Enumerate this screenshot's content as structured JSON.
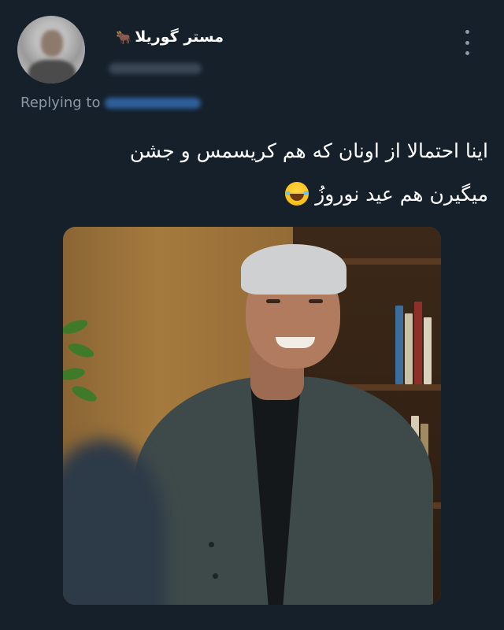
{
  "tweet": {
    "display_name": "مستر گوریلا",
    "display_name_icon": "🐂",
    "replying_to_label": "Replying to",
    "text_line_1": "اینا احتمالا از اونان که هم کریسمس و جشن",
    "text_line_2": "میگیرن هم عید نوروزُ",
    "emoji": "laughing-with-tears-emoji"
  },
  "colors": {
    "background": "#15202b",
    "text_primary": "#ffffff",
    "text_secondary": "#8b98a5",
    "link_blue": "#1d9bf0"
  }
}
